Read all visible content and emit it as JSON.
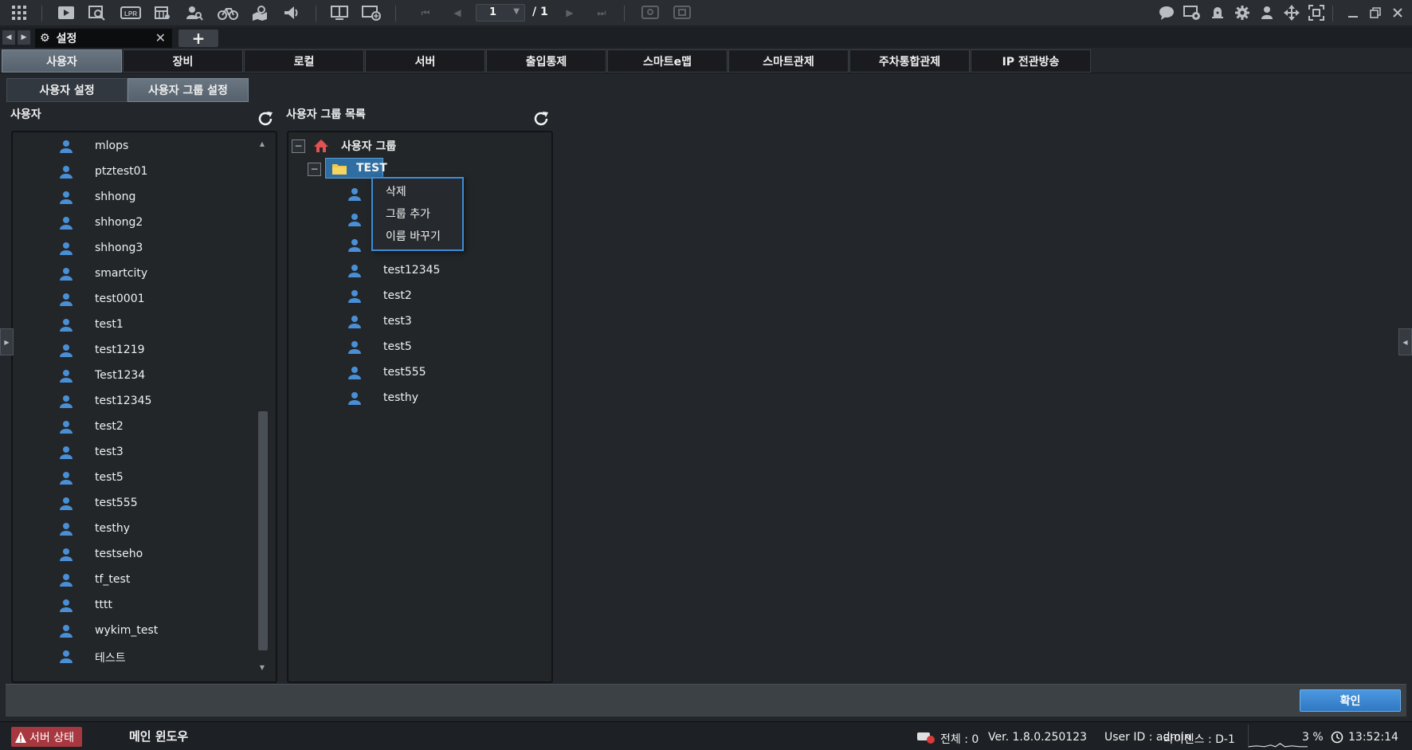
{
  "toolbar": {
    "page_current": "1",
    "page_total": "/ 1",
    "icons_left": [
      "grid-menu-icon",
      "play-icon",
      "search-video-icon",
      "lpr-icon",
      "calendar-grid-icon",
      "person-search-icon",
      "bicycle-icon",
      "map-search-icon",
      "speaker-icon",
      "monitor-split-icon",
      "monitor-add-icon"
    ],
    "lpr_label": "LPR"
  },
  "tabbar": {
    "settings_tab_label": "설정"
  },
  "main_tabs": [
    {
      "label": "사용자",
      "active": true
    },
    {
      "label": "장비",
      "active": false
    },
    {
      "label": "로컬",
      "active": false
    },
    {
      "label": "서버",
      "active": false
    },
    {
      "label": "출입통제",
      "active": false
    },
    {
      "label": "스마트e맵",
      "active": false
    },
    {
      "label": "스마트관제",
      "active": false
    },
    {
      "label": "주차통합관제",
      "active": false
    },
    {
      "label": "IP 전관방송",
      "active": false
    }
  ],
  "sub_tabs": [
    {
      "label": "사용자 설정",
      "active": false
    },
    {
      "label": "사용자 그룹 설정",
      "active": true
    }
  ],
  "users_panel": {
    "title": "사용자",
    "users": [
      "mlops",
      "ptztest01",
      "shhong",
      "shhong2",
      "shhong3",
      "smartcity",
      "test0001",
      "test1",
      "test1219",
      "Test1234",
      "test12345",
      "test2",
      "test3",
      "test5",
      "test555",
      "testhy",
      "testseho",
      "tf_test",
      "tttt",
      "wykim_test",
      "테스트"
    ]
  },
  "groups_panel": {
    "title": "사용자 그룹 목록",
    "root_label": "사용자 그룹",
    "group_label": "TEST",
    "members": [
      "test12345",
      "test2",
      "test3",
      "test5",
      "test555",
      "testhy"
    ]
  },
  "context_menu": {
    "items": [
      "삭제",
      "그룹 추가",
      "이름 바꾸기"
    ]
  },
  "footer": {
    "ok_label": "확인"
  },
  "statusbar": {
    "server_status": "서버 상태",
    "main_window": "메인 윈도우",
    "total": "전체 : 0",
    "version": "Ver. 1.8.0.250123",
    "user_id": "User ID : admin",
    "license": "라이센스 : D-1",
    "cpu": "3 %",
    "time": "13:52:14"
  },
  "colors": {
    "accent": "#2f78c2",
    "alert": "#a8383f",
    "user_icon": "#4a8fd6",
    "folder": "#f2c744",
    "home": "#e25252"
  }
}
